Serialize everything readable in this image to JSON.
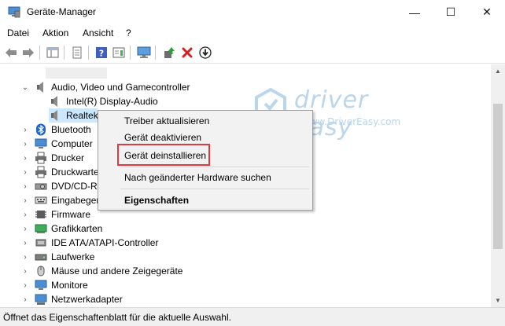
{
  "window": {
    "title": "Geräte-Manager",
    "min_glyph": "—",
    "max_glyph": "☐",
    "close_glyph": "✕"
  },
  "menu": [
    "Datei",
    "Aktion",
    "Ansicht",
    "?"
  ],
  "tree": {
    "category_open": "Audio, Video und Gamecontroller",
    "children": [
      "Intel(R) Display-Audio",
      "Realtek"
    ],
    "categories": [
      "Bluetooth",
      "Computer",
      "Drucker",
      "Druckwarte",
      "DVD/CD-R",
      "Eingabeger",
      "Firmware",
      "Grafikkarten",
      "IDE ATA/ATAPI-Controller",
      "Laufwerke",
      "Mäuse und andere Zeigegeräte",
      "Monitore",
      "Netzwerkadapter"
    ]
  },
  "context_menu": {
    "items": [
      "Treiber aktualisieren",
      "Gerät deaktivieren",
      "Gerät deinstallieren"
    ],
    "scan": "Nach geänderter Hardware suchen",
    "properties": "Eigenschaften"
  },
  "watermark": {
    "brand": "driver easy",
    "url": "www.DriverEasy.com"
  },
  "status": "Öffnet das Eigenschaftenblatt für die aktuelle Auswahl.",
  "colors": {
    "selection": "#cce8ff",
    "highlight_border": "#e0393e",
    "watermark": "#b9d6ec"
  }
}
